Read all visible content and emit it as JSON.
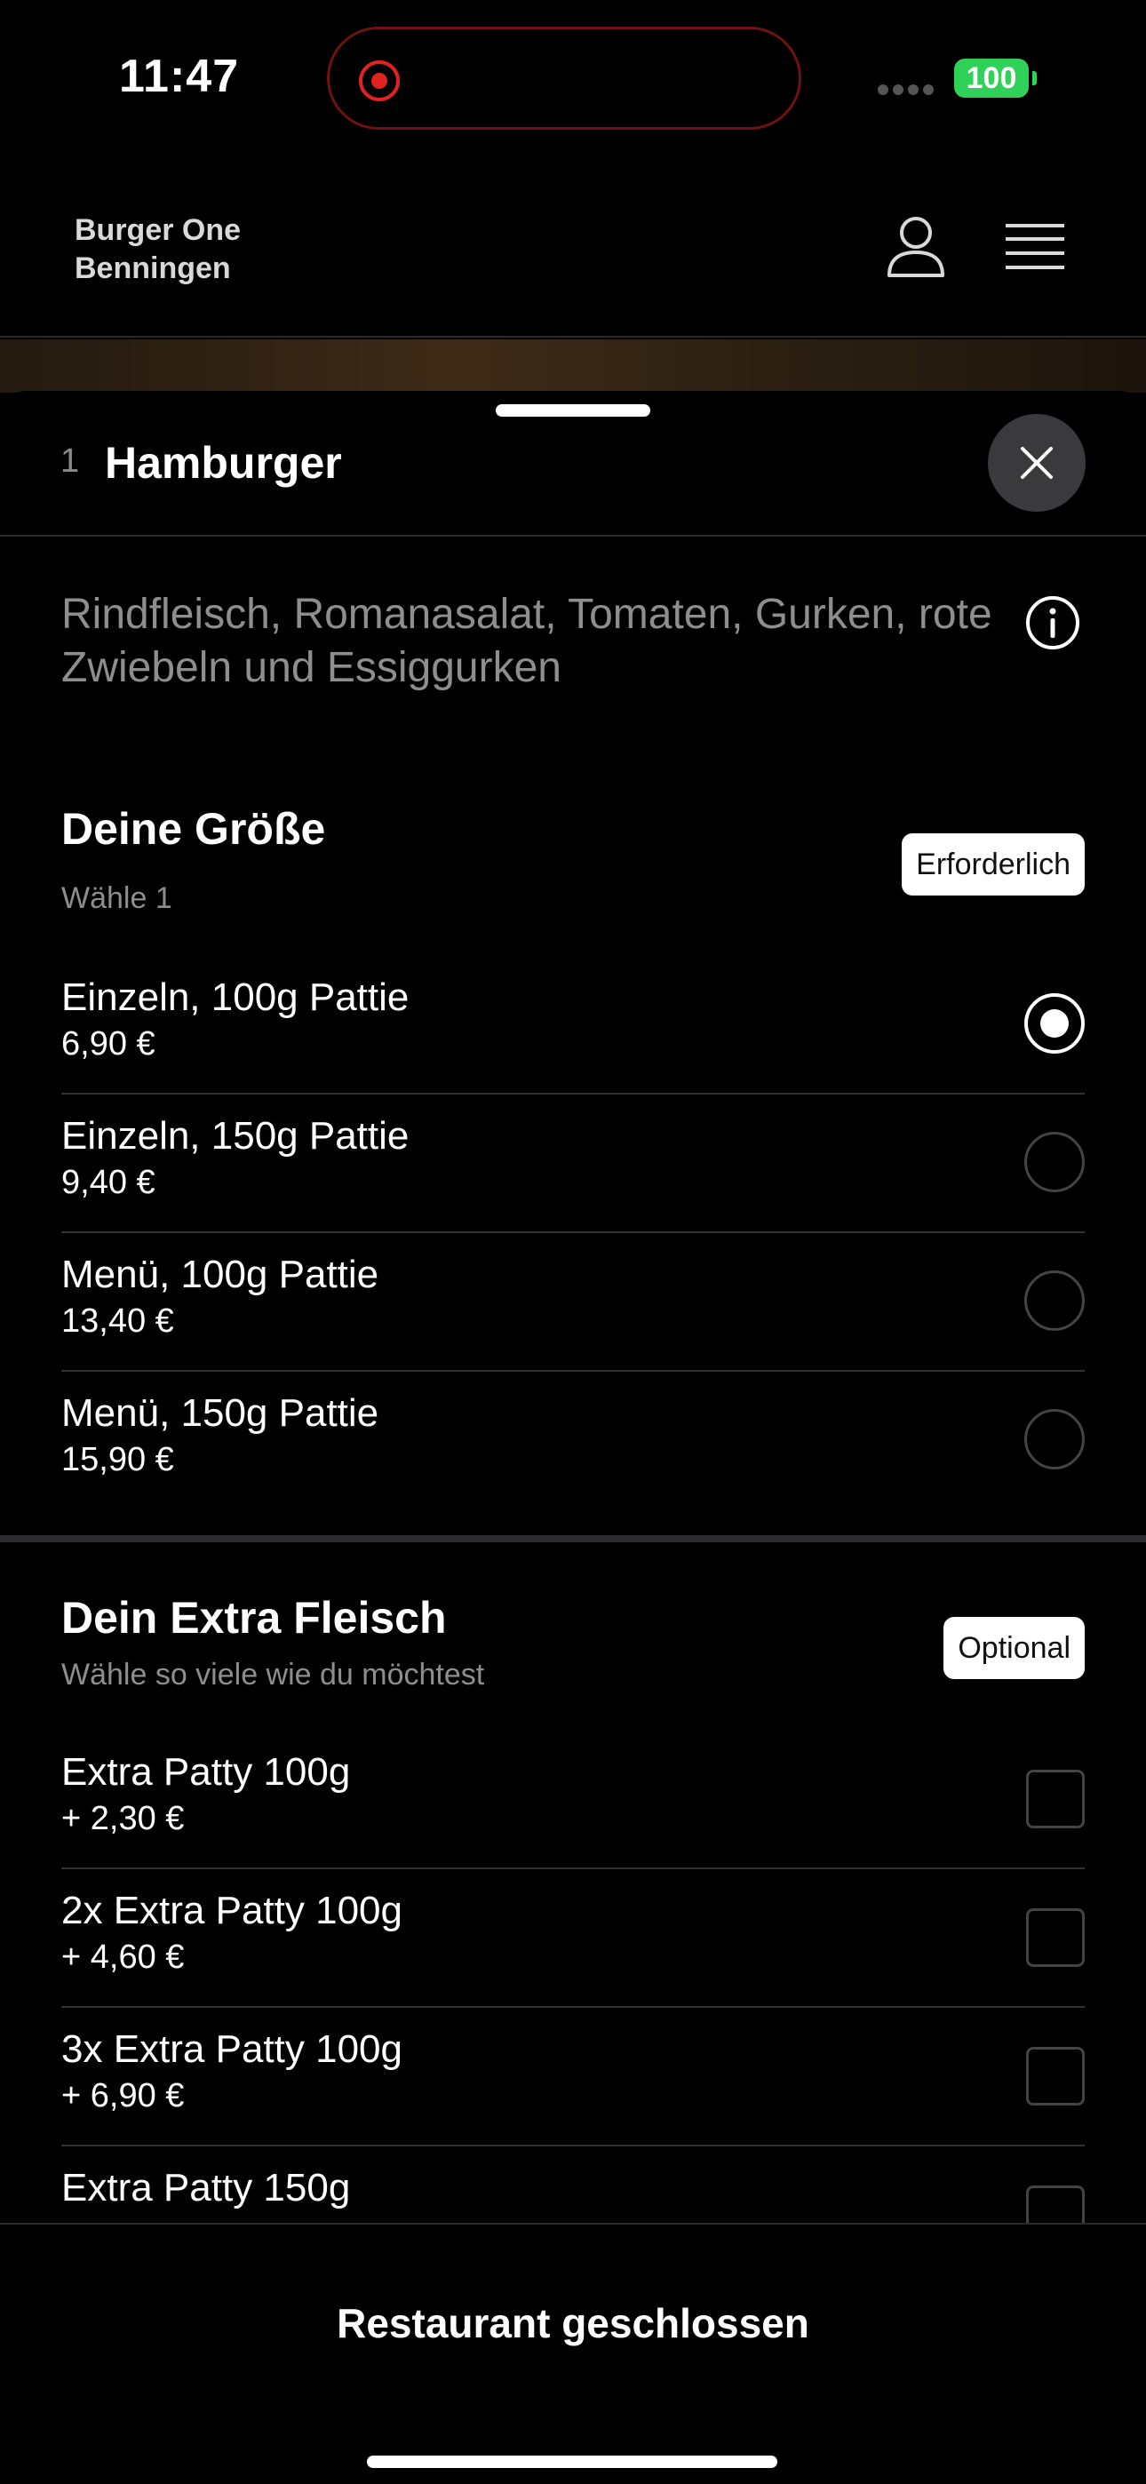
{
  "status_bar": {
    "time": "11:47",
    "battery": "100"
  },
  "header": {
    "restaurant_line1": "Burger One",
    "restaurant_line2": "Benningen"
  },
  "item": {
    "quantity": "1",
    "title": "Hamburger",
    "description": "Rindfleisch, Romanasalat, Tomaten, Gurken, rote Zwiebeln und Essiggurken"
  },
  "size_section": {
    "title": "Deine Größe",
    "subtitle": "Wähle 1",
    "badge": "Erforderlich",
    "options": [
      {
        "name": "Einzeln, 100g Pattie",
        "price": "6,90 €",
        "selected": true
      },
      {
        "name": "Einzeln, 150g Pattie",
        "price": "9,40 €",
        "selected": false
      },
      {
        "name": "Menü, 100g Pattie",
        "price": "13,40 €",
        "selected": false
      },
      {
        "name": "Menü, 150g Pattie",
        "price": "15,90 €",
        "selected": false
      }
    ]
  },
  "extra_section": {
    "title": "Dein Extra Fleisch",
    "subtitle": "Wähle so viele wie du möchtest",
    "badge": "Optional",
    "options": [
      {
        "name": "Extra Patty 100g",
        "price": "+ 2,30 €"
      },
      {
        "name": "2x Extra Patty 100g",
        "price": "+ 4,60 €"
      },
      {
        "name": "3x Extra Patty 100g",
        "price": "+ 6,90 €"
      },
      {
        "name": "Extra Patty 150g",
        "price": ""
      }
    ]
  },
  "footer": {
    "status_label": "Restaurant geschlossen"
  },
  "colors": {
    "background": "#000000",
    "battery": "#30d158",
    "recording": "#e0231e",
    "badge_bg": "#ffffff"
  }
}
